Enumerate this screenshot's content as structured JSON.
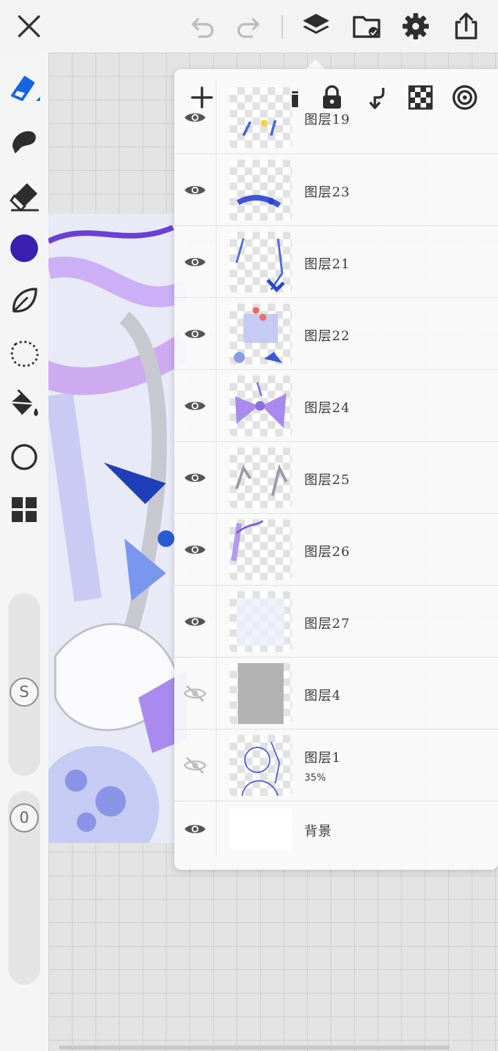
{
  "toolbar": {
    "close": "close-icon",
    "undo": "undo-icon",
    "redo": "redo-icon",
    "layers": "layers-icon",
    "import": "folder-image-icon",
    "settings": "gear-icon",
    "share": "share-icon"
  },
  "tools": {
    "brush": "pen-icon",
    "smudge": "smudge-icon",
    "eraser": "eraser-icon",
    "color": "#3a1fb0",
    "blend": "leaf-icon",
    "lasso": "lasso-icon",
    "fill": "paint-bucket-icon",
    "shape": "circle-icon",
    "more": "grid-icon",
    "size_slider_label": "S",
    "opacity_slider_label": "0"
  },
  "layer_panel": {
    "actions": [
      "add-icon",
      "folder-icon",
      "lock-icon",
      "merge-down-icon",
      "checkerboard-icon",
      "target-icon"
    ],
    "layers": [
      {
        "name": "图层19",
        "visible": true,
        "opacity": ""
      },
      {
        "name": "图层23",
        "visible": true,
        "opacity": ""
      },
      {
        "name": "图层21",
        "visible": true,
        "opacity": ""
      },
      {
        "name": "图层22",
        "visible": true,
        "opacity": ""
      },
      {
        "name": "图层24",
        "visible": true,
        "opacity": ""
      },
      {
        "name": "图层25",
        "visible": true,
        "opacity": ""
      },
      {
        "name": "图层26",
        "visible": true,
        "opacity": ""
      },
      {
        "name": "图层27",
        "visible": true,
        "opacity": ""
      },
      {
        "name": "图层4",
        "visible": false,
        "opacity": ""
      },
      {
        "name": "图层1",
        "visible": false,
        "opacity": "35%"
      },
      {
        "name": "背景",
        "visible": true,
        "opacity": ""
      }
    ]
  },
  "colors": {
    "accent_blue": "#1565e0",
    "current_color": "#3a1fb0"
  }
}
